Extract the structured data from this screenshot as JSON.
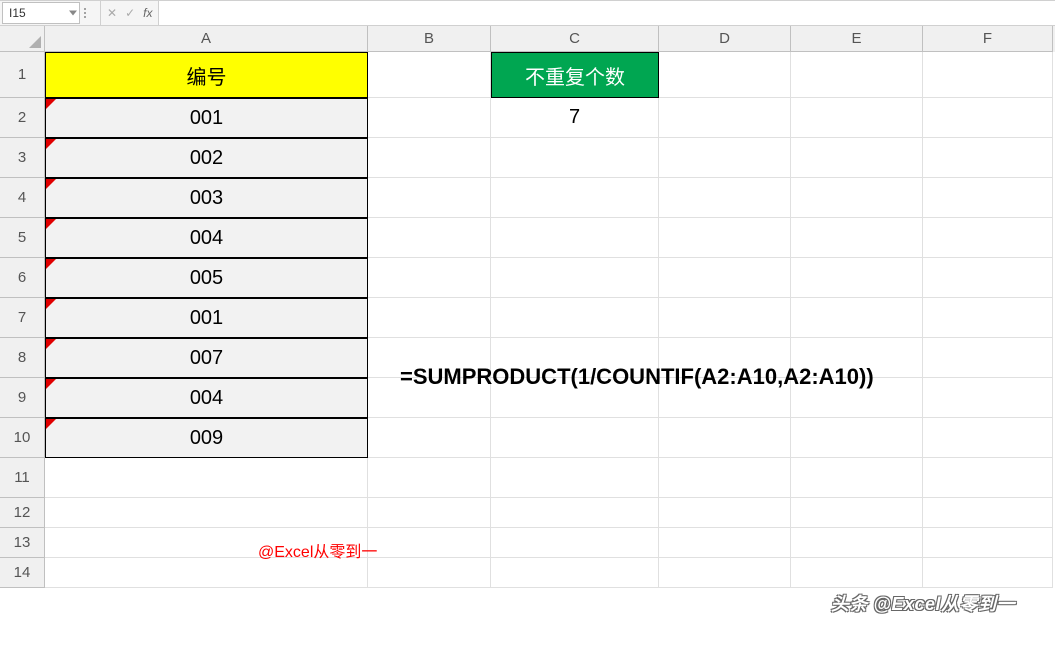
{
  "nameBox": "I15",
  "formulaBar": "",
  "columns": [
    {
      "letter": "A",
      "class": "col-A"
    },
    {
      "letter": "B",
      "class": "col-B"
    },
    {
      "letter": "C",
      "class": "col-C"
    },
    {
      "letter": "D",
      "class": "col-D"
    },
    {
      "letter": "E",
      "class": "col-E"
    },
    {
      "letter": "F",
      "class": "col-F"
    }
  ],
  "rows": [
    {
      "num": "1",
      "heightClass": "row-h1"
    },
    {
      "num": "2",
      "heightClass": "row-tall"
    },
    {
      "num": "3",
      "heightClass": "row-tall"
    },
    {
      "num": "4",
      "heightClass": "row-tall"
    },
    {
      "num": "5",
      "heightClass": "row-tall"
    },
    {
      "num": "6",
      "heightClass": "row-tall"
    },
    {
      "num": "7",
      "heightClass": "row-tall"
    },
    {
      "num": "8",
      "heightClass": "row-tall"
    },
    {
      "num": "9",
      "heightClass": "row-tall"
    },
    {
      "num": "10",
      "heightClass": "row-tall"
    },
    {
      "num": "11",
      "heightClass": "row-tall"
    },
    {
      "num": "12",
      "heightClass": "row-short"
    },
    {
      "num": "13",
      "heightClass": "row-short"
    },
    {
      "num": "14",
      "heightClass": "row-short"
    }
  ],
  "cells": {
    "A1": {
      "value": "编号",
      "class": "header-cell-A"
    },
    "C1": {
      "value": "不重复个数",
      "class": "header-cell-C"
    },
    "A2": {
      "value": "001",
      "class": "data-cell-A",
      "marker": true
    },
    "C2": {
      "value": "7",
      "class": "result-cell"
    },
    "A3": {
      "value": "002",
      "class": "data-cell-A",
      "marker": true
    },
    "A4": {
      "value": "003",
      "class": "data-cell-A",
      "marker": true
    },
    "A5": {
      "value": "004",
      "class": "data-cell-A",
      "marker": true
    },
    "A6": {
      "value": "005",
      "class": "data-cell-A",
      "marker": true
    },
    "A7": {
      "value": "001",
      "class": "data-cell-A",
      "marker": true
    },
    "A8": {
      "value": "007",
      "class": "data-cell-A",
      "marker": true
    },
    "A9": {
      "value": "004",
      "class": "data-cell-A",
      "marker": true
    },
    "A10": {
      "value": "009",
      "class": "data-cell-A",
      "marker": true
    }
  },
  "overlayFormula": "=SUMPRODUCT(1/COUNTIF(A2:A10,A2:A10))",
  "overlayCredit": "@Excel从零到一",
  "watermark": "头条 @Excel从零到一"
}
